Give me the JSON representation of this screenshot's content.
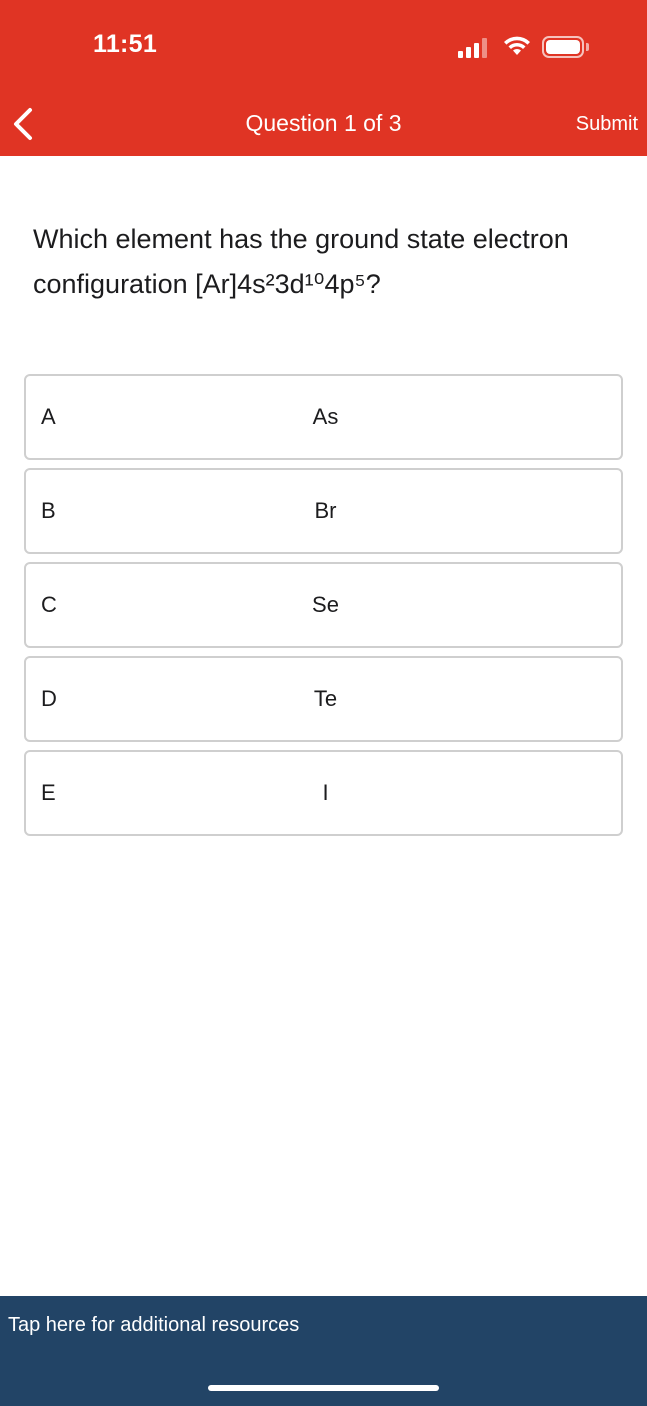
{
  "status_bar": {
    "time": "11:51",
    "icons": [
      "signal-icon",
      "wifi-icon",
      "battery-icon"
    ]
  },
  "header": {
    "title": "Question 1 of 3",
    "submit_label": "Submit",
    "back_icon": "chevron-left-icon",
    "background_color": "#e03424"
  },
  "question": {
    "text": "Which element has the ground state electron configuration [Ar]4s²3d¹⁰4p⁵?"
  },
  "options": [
    {
      "letter": "A",
      "text": "As"
    },
    {
      "letter": "B",
      "text": "Br"
    },
    {
      "letter": "C",
      "text": "Se"
    },
    {
      "letter": "D",
      "text": "Te"
    },
    {
      "letter": "E",
      "text": "I"
    }
  ],
  "footer": {
    "resources_label": "Tap here for additional resources",
    "background_color": "#224466"
  }
}
